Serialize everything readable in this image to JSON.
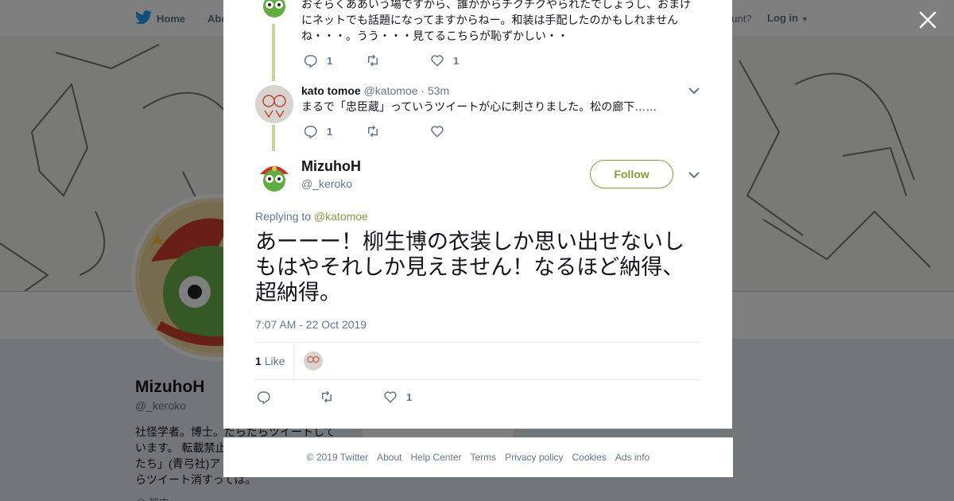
{
  "background": {
    "nav": {
      "home": "Home",
      "about": "Abo",
      "account_prompt": "ccount?",
      "login": "Log in"
    },
    "profile": {
      "name": "MizuhoH",
      "handle": "@_keroko",
      "bio": "社怪学者。博士。だらだらツイートして\nいます。 転載禁止\nたち」(青弓社)ア\nらツイート消すっては。",
      "card_text": "Ads info",
      "location": "@ 都内"
    }
  },
  "modal": {
    "close_label": "×",
    "tweet1": {
      "text": "おそらくああいう場ですから、誰かからチクチクやられたでしょうし、おまけにネットでも話題になってますからねー。和装は手配したのかもしれませんね・・・。うう・・・見てるこちらが恥ずかしい・・",
      "reply_count": "1",
      "like_count": "1"
    },
    "tweet2": {
      "name": "kato tomoe",
      "handle": "@katomoe",
      "time": "· 53m",
      "text": "まるで「忠臣蔵」っていうツイートが心に刺さりました。松の廊下……",
      "reply_count": "1"
    },
    "main": {
      "name": "MizuhoH",
      "handle": "@_keroko",
      "follow_label": "Follow",
      "replying_prefix": "Replying to",
      "replying_to": "@katomoe",
      "text": "あーーー！柳生博の衣装しか思い出せないしもはやそれしか見えません！なるほど納得、超納得。",
      "timestamp": "7:07 AM - 22 Oct 2019",
      "like_count": "1",
      "like_label": "Like",
      "action_like_count": "1"
    }
  },
  "footer": {
    "items": [
      "© 2019 Twitter",
      "About",
      "Help Center",
      "Terms",
      "Privacy policy",
      "Cookies",
      "Ads info"
    ]
  },
  "colors": {
    "accent": "#8a9a3b",
    "thread_line": "#c8d39b",
    "muted": "#657786",
    "overlay": "rgba(0,0,0,0.5)"
  },
  "icons": [
    "twitter-bird-icon",
    "reply-icon",
    "retweet-icon",
    "heart-icon",
    "chevron-down-icon",
    "close-icon"
  ]
}
